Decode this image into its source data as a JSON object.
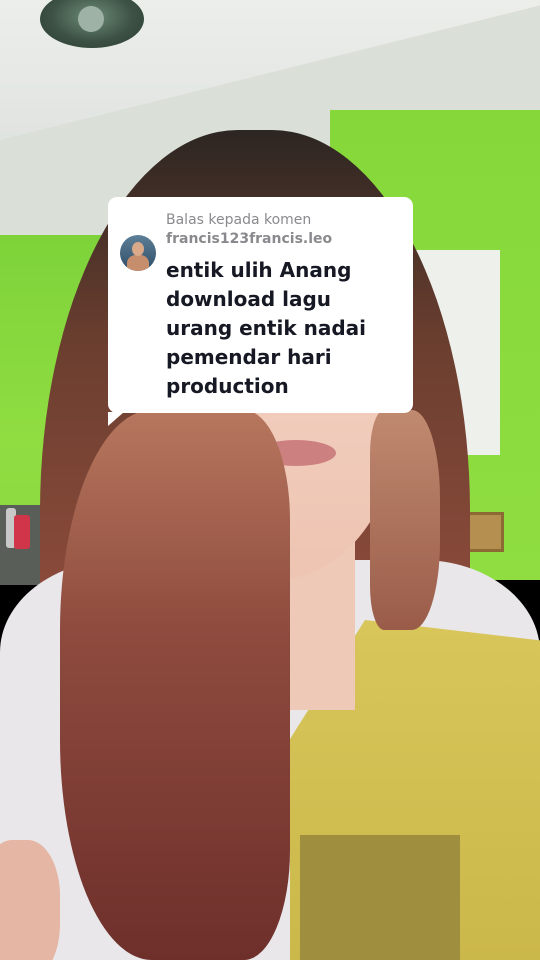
{
  "reply_sticker": {
    "header_label": "Balas kepada komen",
    "username": "francis123francis.leo",
    "comment_text": "entik ulih Anang download lagu urang entik nadai pemendar hari production",
    "avatar_icon": "user-avatar-icon"
  },
  "colors": {
    "card_bg": "#ffffff",
    "header_text": "#8a8a8e",
    "body_text": "#161823",
    "wall_green": "#8fdd41"
  }
}
